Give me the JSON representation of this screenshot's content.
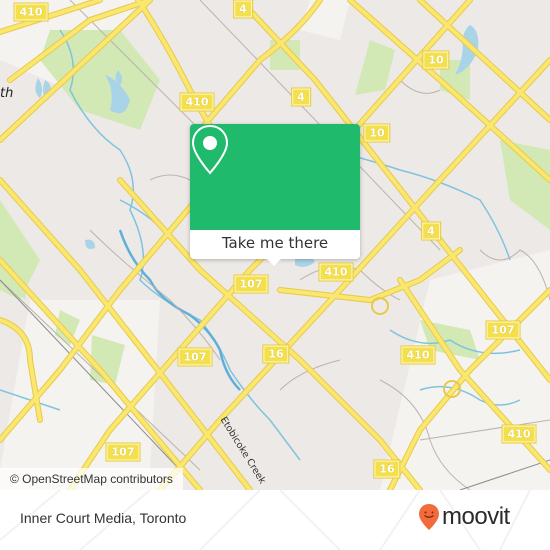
{
  "map": {
    "attribution": "© OpenStreetMap contributors",
    "place_label": "th",
    "creek_label": "Etobicoke Creek",
    "route_shields": [
      {
        "label": "410",
        "id": "410-a"
      },
      {
        "label": "4",
        "id": "4-a"
      },
      {
        "label": "410",
        "id": "410-b"
      },
      {
        "label": "4",
        "id": "4-b"
      },
      {
        "label": "10",
        "id": "10-a"
      },
      {
        "label": "10",
        "id": "10-b"
      },
      {
        "label": "4",
        "id": "4-c"
      },
      {
        "label": "410",
        "id": "410-c"
      },
      {
        "label": "107",
        "id": "107-a"
      },
      {
        "label": "107",
        "id": "107-b"
      },
      {
        "label": "16",
        "id": "16-a"
      },
      {
        "label": "410",
        "id": "410-d"
      },
      {
        "label": "107",
        "id": "107-c"
      },
      {
        "label": "410",
        "id": "410-e"
      },
      {
        "label": "107",
        "id": "107-d"
      },
      {
        "label": "16",
        "id": "16-b"
      }
    ],
    "colors": {
      "land": "#ede9e6",
      "park": "#cfe8b0",
      "water": "#aad3df",
      "road": "#f7e26b",
      "accent": "#1fba6b"
    }
  },
  "popup": {
    "icon": "map-pin-icon",
    "button_label": "Take me there"
  },
  "footer": {
    "title": "Inner Court Media, Toronto",
    "brand": "moovit",
    "brand_color": "#f26b3a"
  }
}
